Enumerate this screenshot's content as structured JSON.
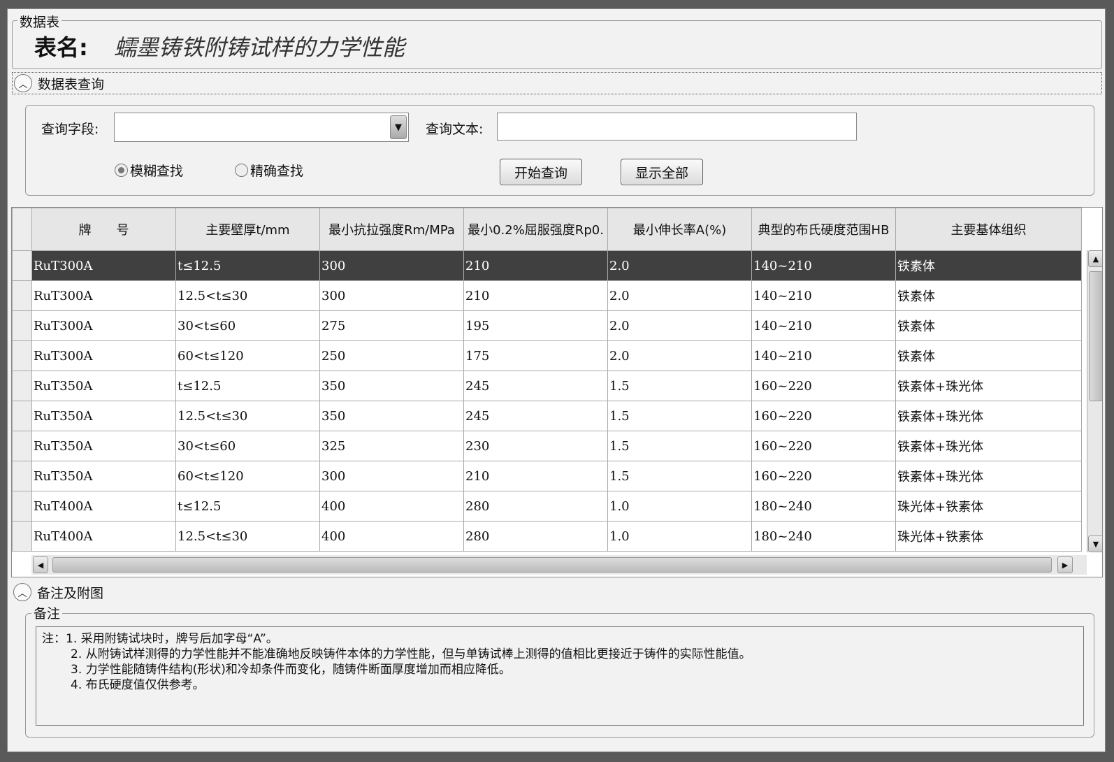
{
  "header": {
    "group_label": "数据表",
    "title_label": "表名:",
    "title_value": "蠕墨铸铁附铸试样的力学性能"
  },
  "query": {
    "section_label": "数据表查询",
    "field_label": "查询字段:",
    "field_value": "",
    "text_label": "查询文本:",
    "text_value": "",
    "radio_fuzzy": "模糊查找",
    "radio_exact": "精确查找",
    "selected_radio": "模糊查找",
    "search_button": "开始查询",
    "show_all_button": "显示全部"
  },
  "table": {
    "columns": [
      "牌　　号",
      "主要壁厚t/mm",
      "最小抗拉强度Rm/MPa",
      "最小0.2%屈服强度Rp0.",
      "最小伸长率A(%)",
      "典型的布氏硬度范围HB",
      "主要基体组织"
    ],
    "rows": [
      [
        "RuT300A",
        "t≤12.5",
        "300",
        "210",
        "2.0",
        "140~210",
        "铁素体"
      ],
      [
        "RuT300A",
        "12.5<t≤30",
        "300",
        "210",
        "2.0",
        "140~210",
        "铁素体"
      ],
      [
        "RuT300A",
        "30<t≤60",
        "275",
        "195",
        "2.0",
        "140~210",
        "铁素体"
      ],
      [
        "RuT300A",
        "60<t≤120",
        "250",
        "175",
        "2.0",
        "140~210",
        "铁素体"
      ],
      [
        "RuT350A",
        "t≤12.5",
        "350",
        "245",
        "1.5",
        "160~220",
        "铁素体+珠光体"
      ],
      [
        "RuT350A",
        "12.5<t≤30",
        "350",
        "245",
        "1.5",
        "160~220",
        "铁素体+珠光体"
      ],
      [
        "RuT350A",
        "30<t≤60",
        "325",
        "230",
        "1.5",
        "160~220",
        "铁素体+珠光体"
      ],
      [
        "RuT350A",
        "60<t≤120",
        "300",
        "210",
        "1.5",
        "160~220",
        "铁素体+珠光体"
      ],
      [
        "RuT400A",
        "t≤12.5",
        "400",
        "280",
        "1.0",
        "180~240",
        "珠光体+铁素体"
      ],
      [
        "RuT400A",
        "12.5<t≤30",
        "400",
        "280",
        "1.0",
        "180~240",
        "珠光体+铁素体"
      ]
    ],
    "selected_row": 0
  },
  "notes": {
    "section_label": "备注及附图",
    "group_label": "备注",
    "lines": [
      "注：1. 采用附铸试块时，牌号后加字母“A”。",
      "2. 从附铸试样测得的力学性能并不能准确地反映铸件本体的力学性能，但与单铸试棒上测得的值相比更接近于铸件的实际性能值。",
      "3. 力学性能随铸件结构(形状)和冷却条件而变化，随铸件断面厚度增加而相应降低。",
      "4. 布氏硬度值仅供参考。"
    ]
  }
}
